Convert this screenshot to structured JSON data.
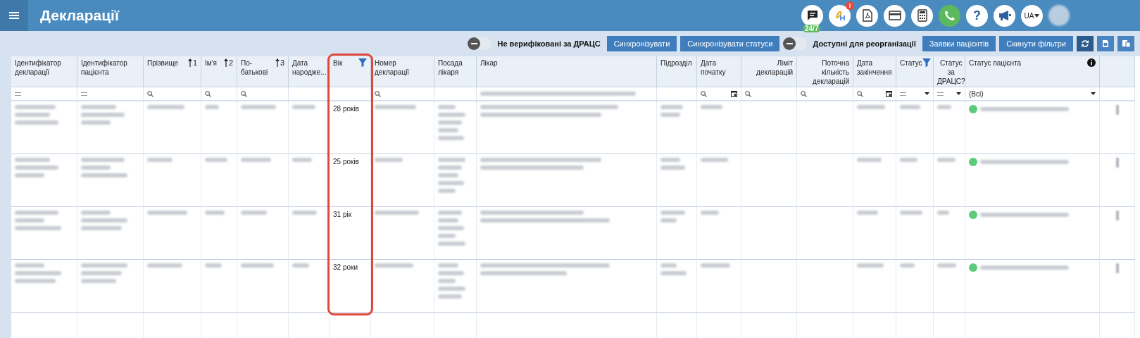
{
  "header": {
    "title": "Декларації",
    "icons": [
      {
        "kind": "chat",
        "badge": "24/7"
      },
      {
        "kind": "logo",
        "alert": "!"
      },
      {
        "kind": "pdf"
      },
      {
        "kind": "card"
      },
      {
        "kind": "calculator"
      },
      {
        "kind": "phone"
      },
      {
        "kind": "help",
        "label": "?"
      },
      {
        "kind": "megaphone"
      }
    ],
    "language": "UA"
  },
  "toolbar": [
    {
      "kind": "toggle",
      "label": "Не верифіковані за ДРАЦС",
      "on": false
    },
    {
      "kind": "button",
      "label": "Синхронізувати"
    },
    {
      "kind": "button",
      "label": "Синхронізувати статуси"
    },
    {
      "kind": "toggle",
      "label": "Доступні для реорганізації",
      "on": false
    },
    {
      "kind": "button",
      "label": "Заявки пацієнтів"
    },
    {
      "kind": "button",
      "label": "Скинути фільтри"
    },
    {
      "kind": "refresh"
    },
    {
      "kind": "export"
    },
    {
      "kind": "columns"
    }
  ],
  "table": {
    "columns": [
      {
        "label": "Ідентифікатор декларації",
        "kind": "blurred"
      },
      {
        "label": "Ідентифікатор пацієнта",
        "kind": "blurred"
      },
      {
        "label": "Прізвище",
        "sort": "1",
        "kind": "blurred"
      },
      {
        "label": "Ім'я",
        "sort": "2",
        "kind": "blurred"
      },
      {
        "label": "По-батькові",
        "sort": "3",
        "kind": "blurred"
      },
      {
        "label": "Дата народже...",
        "kind": "blurred"
      },
      {
        "label": "Вік",
        "filter_active": true,
        "highlighted": true,
        "kind": "age"
      },
      {
        "label": "Номер декларації",
        "kind": "blurred"
      },
      {
        "label": "Посада лікаря",
        "kind": "blurred"
      },
      {
        "label": "Лікар",
        "kind": "blurred"
      },
      {
        "label": "Підрозділ",
        "kind": "blurred"
      },
      {
        "label": "Дата початку",
        "kind": "blurred"
      },
      {
        "label": "Ліміт декларацій",
        "right_aligned": true,
        "kind": "empty"
      },
      {
        "label": "Поточна кількість декларацій",
        "right_aligned": true,
        "kind": "empty"
      },
      {
        "label": "Дата закінчення",
        "kind": "blurred"
      },
      {
        "label": "Статус",
        "filter_active": true,
        "kind": "blurred"
      },
      {
        "label": "Статус за ДРАЦС?",
        "centered": true,
        "kind": "blurred"
      },
      {
        "label": "Статус пацієнта",
        "info": true,
        "kind": "status"
      },
      {
        "kind": "menu"
      }
    ],
    "filters": [
      {
        "kind": "equals"
      },
      {
        "kind": "equals"
      },
      {
        "kind": "search"
      },
      {
        "kind": "search"
      },
      {
        "kind": "search"
      },
      {
        "kind": "empty"
      },
      {
        "kind": "empty"
      },
      {
        "kind": "search"
      },
      {
        "kind": "empty"
      },
      {
        "kind": "blurred"
      },
      {
        "kind": "empty"
      },
      {
        "kind": "date"
      },
      {
        "kind": "search"
      },
      {
        "kind": "search"
      },
      {
        "kind": "date"
      },
      {
        "kind": "dropdown"
      },
      {
        "kind": "dropdown"
      },
      {
        "kind": "select",
        "value": "(Всі)"
      },
      {
        "kind": "empty"
      }
    ],
    "rows": [
      {
        "age": "28 років",
        "color": "#5ccb7c"
      },
      {
        "age": "25 років",
        "color": "#5ccb7c"
      },
      {
        "age": "31 рік",
        "color": "#5ccb7c"
      },
      {
        "age": "32 роки",
        "color": "#5ccb7c"
      }
    ]
  }
}
